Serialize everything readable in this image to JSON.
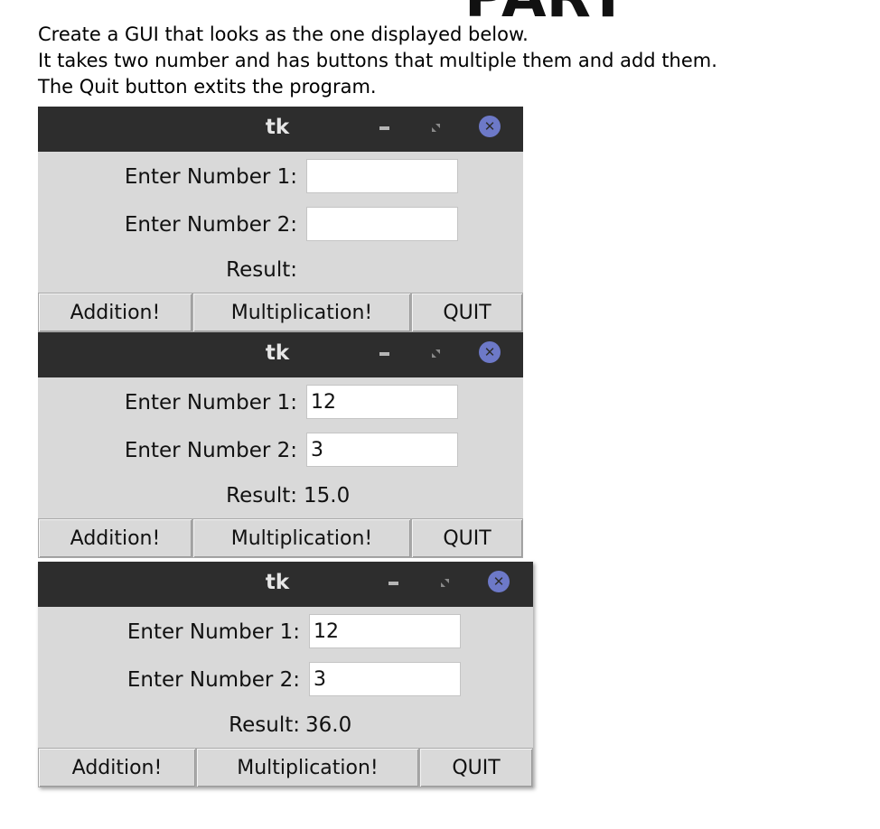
{
  "header": {
    "partial_title": "PART"
  },
  "intro": [
    "Create a GUI that looks as the one displayed below.",
    "It takes two number and has buttons that multiple them and add them.",
    "The Quit button extits the program."
  ],
  "windows": [
    {
      "title": "tk",
      "label1": "Enter Number 1:",
      "label2": "Enter Number 2:",
      "value1": "",
      "value2": "",
      "result_label": "Result:",
      "result_value": "",
      "buttons": {
        "add": "Addition!",
        "multiply": "Multiplication!",
        "quit": "QUIT"
      }
    },
    {
      "title": "tk",
      "label1": "Enter Number 1:",
      "label2": "Enter Number 2:",
      "value1": "12",
      "value2": "3",
      "result_label": "Result:",
      "result_value": "15.0",
      "buttons": {
        "add": "Addition!",
        "multiply": "Multiplication!",
        "quit": "QUIT"
      }
    },
    {
      "title": "tk",
      "label1": "Enter Number 1:",
      "label2": "Enter Number 2:",
      "value1": "12",
      "value2": "3",
      "result_label": "Result:",
      "result_value": "36.0",
      "buttons": {
        "add": "Addition!",
        "multiply": "Multiplication!",
        "quit": "QUIT"
      }
    }
  ],
  "colors": {
    "titlebar": "#2d2d2d",
    "window_bg": "#d9d9d9",
    "close_button": "#6d79c8"
  },
  "icons": {
    "minimize": "minimize-icon",
    "restore": "restore-icon",
    "close": "close-icon"
  }
}
